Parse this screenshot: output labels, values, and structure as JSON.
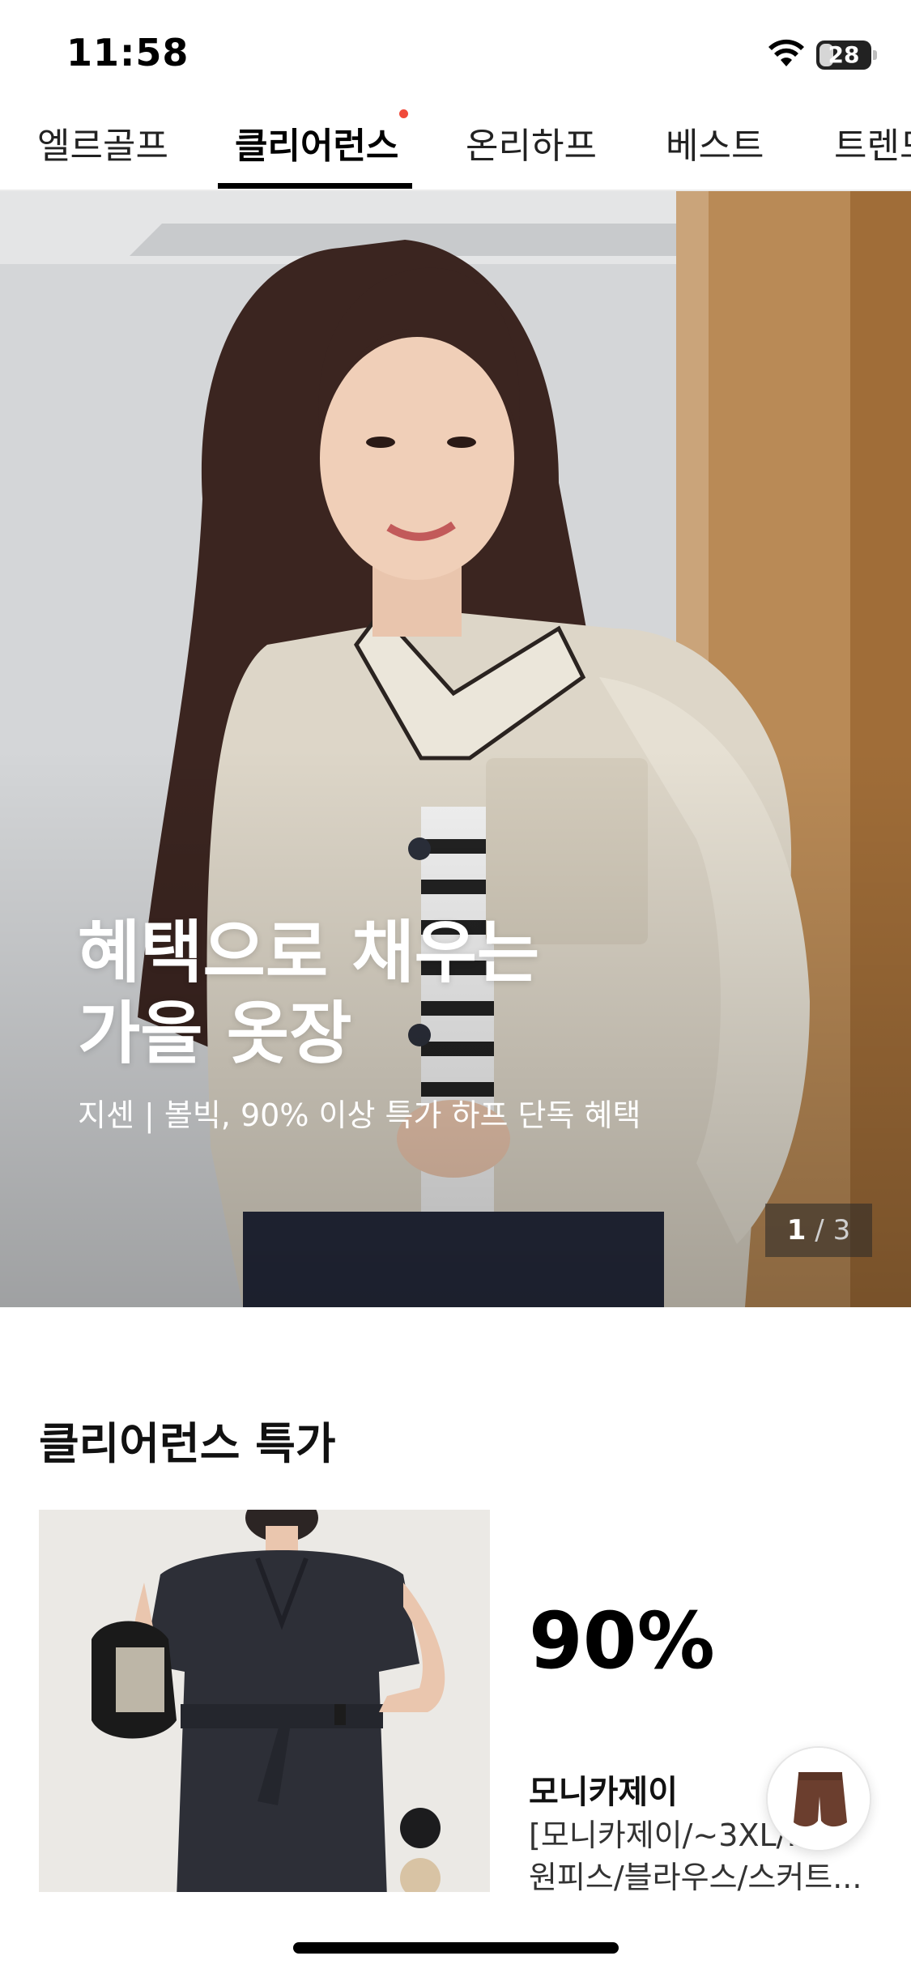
{
  "status_bar": {
    "time": "11:58",
    "battery": "28",
    "battery_fraction": 0.28
  },
  "tabs": [
    {
      "label": "엘르골프"
    },
    {
      "label": "클리어런스"
    },
    {
      "label": "온리하프"
    },
    {
      "label": "베스트"
    },
    {
      "label": "트렌드"
    }
  ],
  "active_tab": "클리어런스",
  "hero": {
    "title_line1": "혜택으로 채우는",
    "title_line2": "가을 옷장",
    "subtitle": "지센 | 볼빅, 90% 이상 특가 하프 단독 혜택",
    "page_current": "1",
    "page_separator": "/",
    "page_total": "3"
  },
  "section": {
    "title": "클리어런스 특가",
    "product": {
      "discount": "90%",
      "brand": "모니카제이",
      "desc_line1": "[모니카제이/~3XL/...]",
      "desc_line2": "원피스/블라우스/스커트..."
    },
    "swatch_colors": [
      "#1c1c1e",
      "#d8c3a4"
    ]
  },
  "colors": {
    "accent_dot": "#f04a3a",
    "tab_active": "#000000"
  },
  "icons": {
    "wifi": "wifi-icon",
    "battery": "battery-icon",
    "floating": "recent-item-thumbnail"
  }
}
